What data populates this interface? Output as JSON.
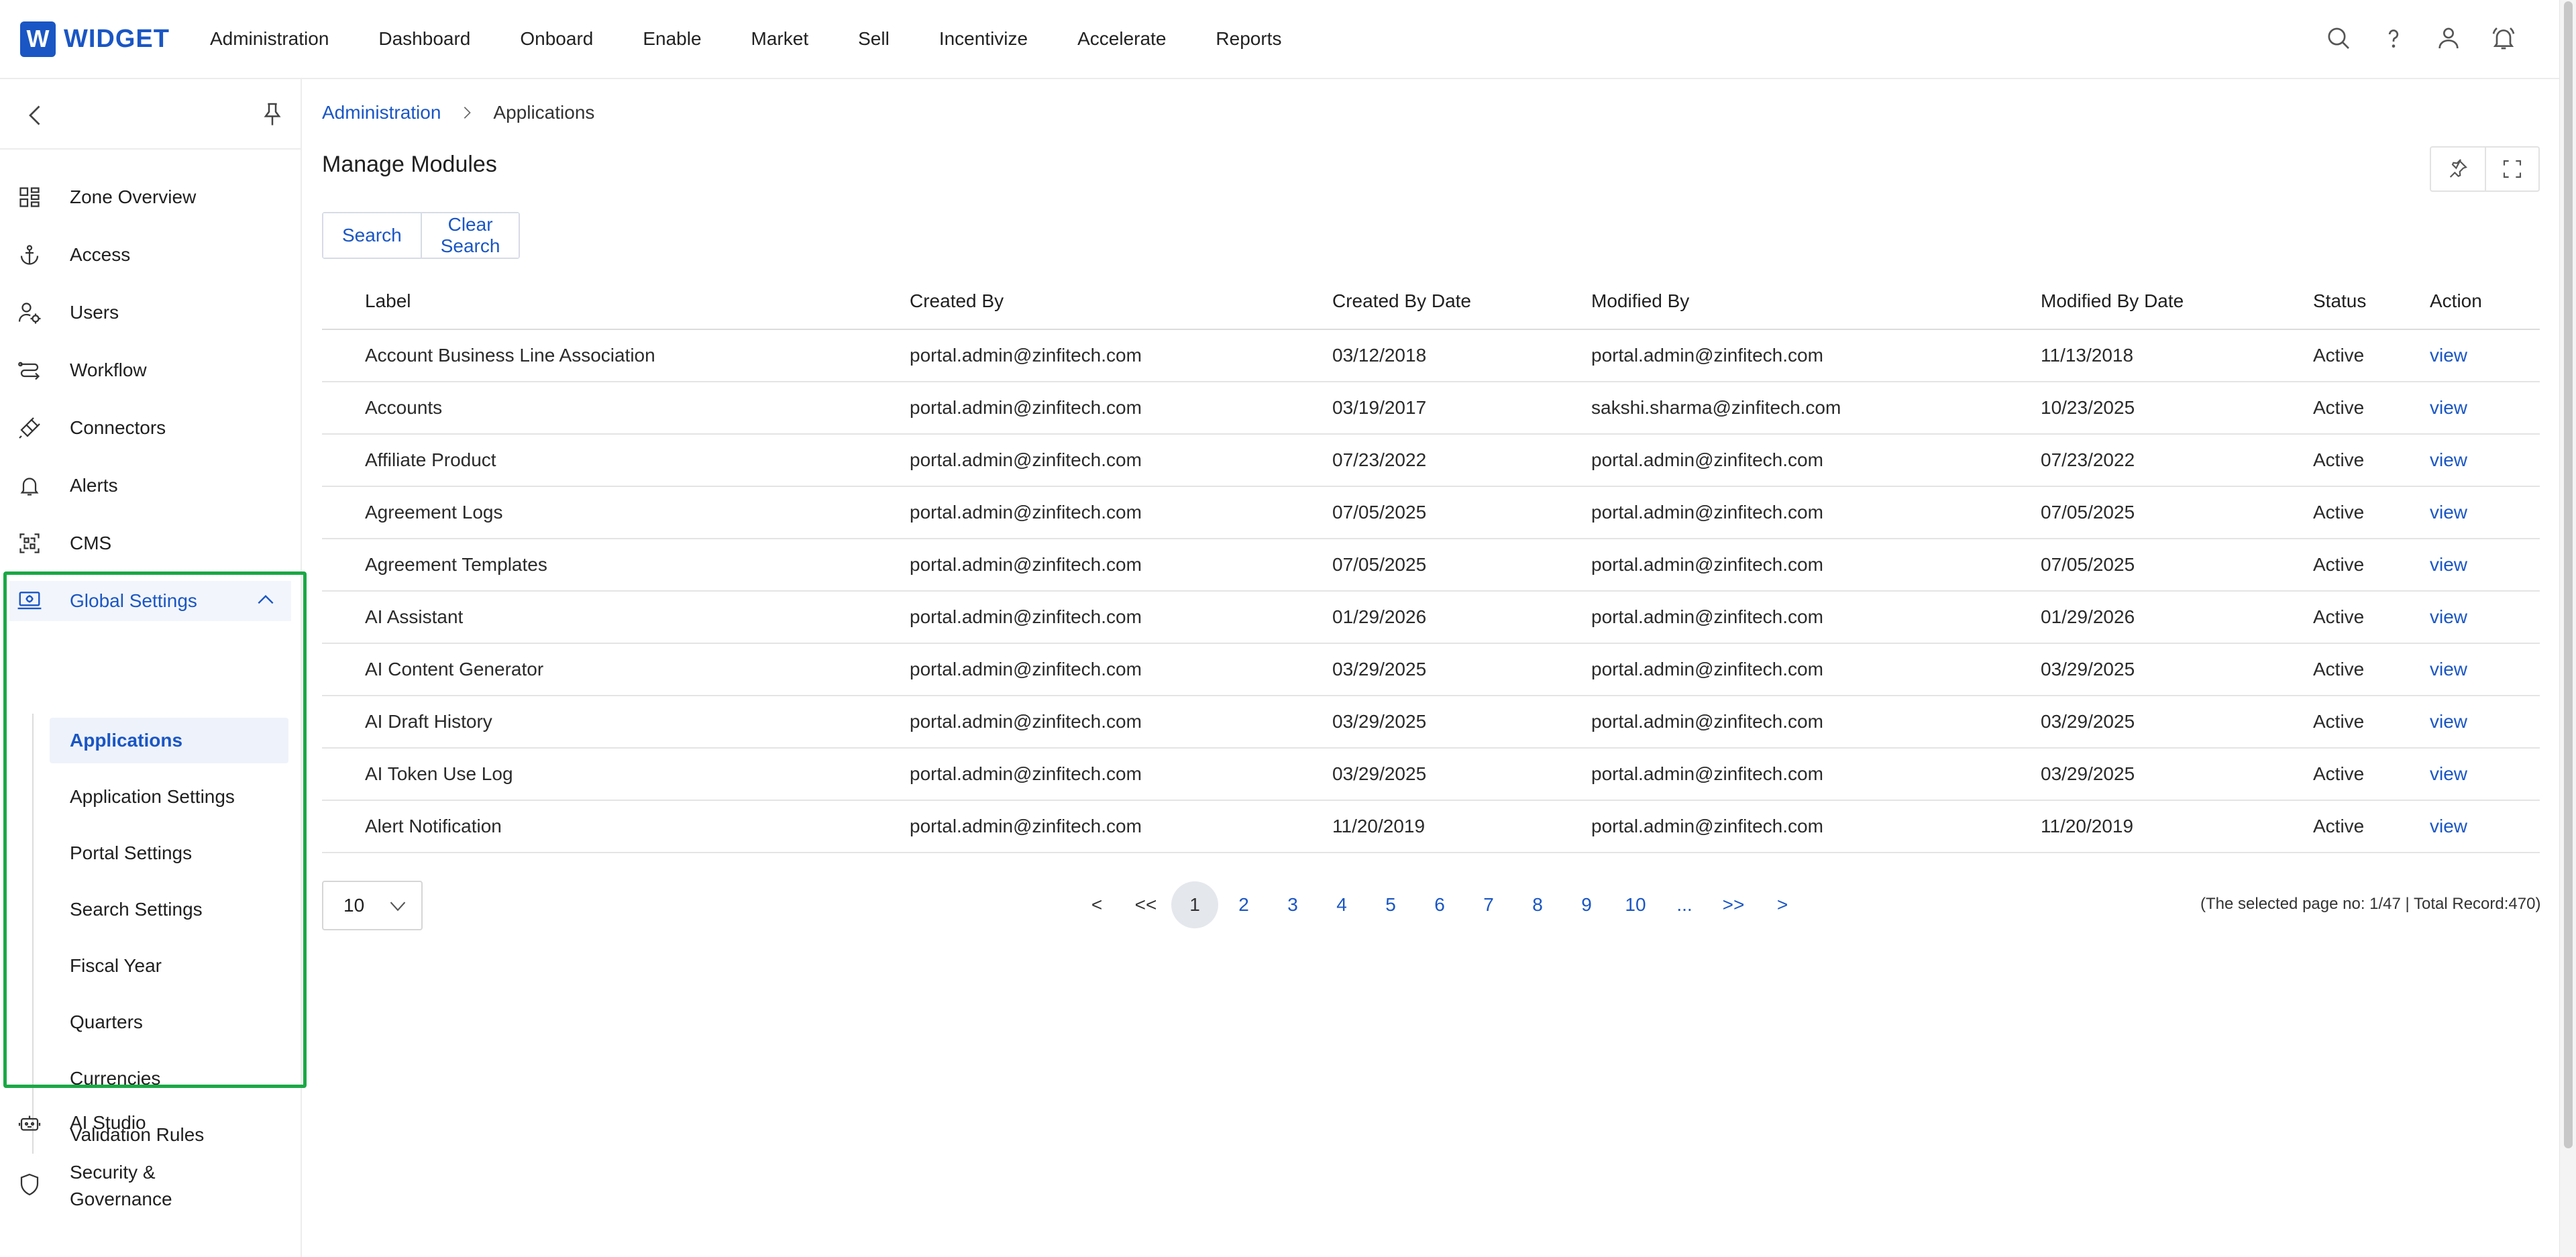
{
  "brand": {
    "logo_letter": "W",
    "name": "WIDGET",
    "color": "#1a56c4"
  },
  "topnav": {
    "items": [
      "Administration",
      "Dashboard",
      "Onboard",
      "Enable",
      "Market",
      "Sell",
      "Incentivize",
      "Accelerate",
      "Reports"
    ],
    "icons": [
      "search-icon",
      "help-icon",
      "user-icon",
      "bell-icon"
    ]
  },
  "sidebar": {
    "items": [
      {
        "label": "Zone Overview",
        "icon": "grid-icon"
      },
      {
        "label": "Access",
        "icon": "anchor-icon"
      },
      {
        "label": "Users",
        "icon": "users-gear-icon"
      },
      {
        "label": "Workflow",
        "icon": "workflow-icon"
      },
      {
        "label": "Connectors",
        "icon": "plug-icon"
      },
      {
        "label": "Alerts",
        "icon": "bell-icon"
      },
      {
        "label": "CMS",
        "icon": "cms-icon"
      },
      {
        "label": "Global Settings",
        "icon": "monitor-settings-icon"
      },
      {
        "label": "AI Studio",
        "icon": "robot-icon"
      },
      {
        "label": "Security &",
        "label2": "Governance",
        "icon": "shield-icon"
      }
    ],
    "sub_items": [
      "Applications",
      "Application Settings",
      "Portal Settings",
      "Search Settings",
      "Fiscal Year",
      "Quarters",
      "Currencies",
      "Validation Rules"
    ],
    "highlight_color": "#1aa845"
  },
  "breadcrumb": {
    "parent": "Administration",
    "current": "Applications"
  },
  "page": {
    "title": "Manage Modules"
  },
  "search": {
    "search_label": "Search",
    "clear_label": "Clear Search"
  },
  "table": {
    "columns": [
      "Label",
      "Created By",
      "Created By Date",
      "Modified By",
      "Modified By Date",
      "Status",
      "Action"
    ],
    "rows": [
      [
        "Account Business Line Association",
        "portal.admin@zinfitech.com",
        "03/12/2018",
        "portal.admin@zinfitech.com",
        "11/13/2018",
        "Active",
        "view"
      ],
      [
        "Accounts",
        "portal.admin@zinfitech.com",
        "03/19/2017",
        "sakshi.sharma@zinfitech.com",
        "10/23/2025",
        "Active",
        "view"
      ],
      [
        "Affiliate Product",
        "portal.admin@zinfitech.com",
        "07/23/2022",
        "portal.admin@zinfitech.com",
        "07/23/2022",
        "Active",
        "view"
      ],
      [
        "Agreement Logs",
        "portal.admin@zinfitech.com",
        "07/05/2025",
        "portal.admin@zinfitech.com",
        "07/05/2025",
        "Active",
        "view"
      ],
      [
        "Agreement Templates",
        "portal.admin@zinfitech.com",
        "07/05/2025",
        "portal.admin@zinfitech.com",
        "07/05/2025",
        "Active",
        "view"
      ],
      [
        "AI Assistant",
        "portal.admin@zinfitech.com",
        "01/29/2026",
        "portal.admin@zinfitech.com",
        "01/29/2026",
        "Active",
        "view"
      ],
      [
        "AI Content Generator",
        "portal.admin@zinfitech.com",
        "03/29/2025",
        "portal.admin@zinfitech.com",
        "03/29/2025",
        "Active",
        "view"
      ],
      [
        "AI Draft History",
        "portal.admin@zinfitech.com",
        "03/29/2025",
        "portal.admin@zinfitech.com",
        "03/29/2025",
        "Active",
        "view"
      ],
      [
        "AI Token Use Log",
        "portal.admin@zinfitech.com",
        "03/29/2025",
        "portal.admin@zinfitech.com",
        "03/29/2025",
        "Active",
        "view"
      ],
      [
        "Alert Notification",
        "portal.admin@zinfitech.com",
        "11/20/2019",
        "portal.admin@zinfitech.com",
        "11/20/2019",
        "Active",
        "view"
      ]
    ]
  },
  "pagination": {
    "page_size": "10",
    "first_prev": "<",
    "prev_block": "<<",
    "pages": [
      "1",
      "2",
      "3",
      "4",
      "5",
      "6",
      "7",
      "8",
      "9",
      "10",
      "..."
    ],
    "next_block": ">>",
    "next": ">",
    "info": "(The selected page no: 1/47 | Total Record:470)"
  }
}
